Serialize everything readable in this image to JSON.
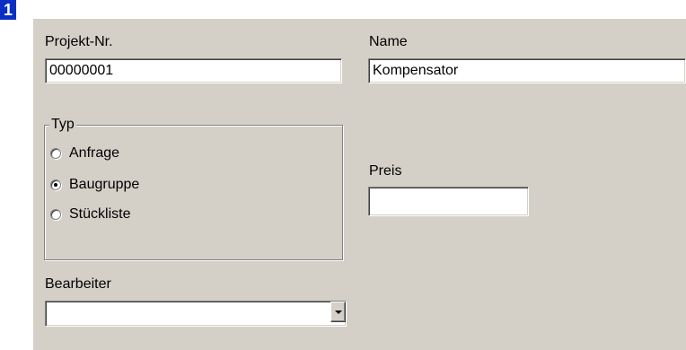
{
  "step_number": "1",
  "form": {
    "project_no": {
      "label": "Projekt-Nr.",
      "value": "00000001"
    },
    "name": {
      "label": "Name",
      "value": "Kompensator"
    },
    "type_group": {
      "title": "Typ",
      "options": [
        {
          "label": "Anfrage",
          "selected": false
        },
        {
          "label": "Baugruppe",
          "selected": true
        },
        {
          "label": "Stückliste",
          "selected": false
        }
      ]
    },
    "price": {
      "label": "Preis",
      "value": ""
    },
    "editor": {
      "label": "Bearbeiter",
      "value": ""
    }
  }
}
